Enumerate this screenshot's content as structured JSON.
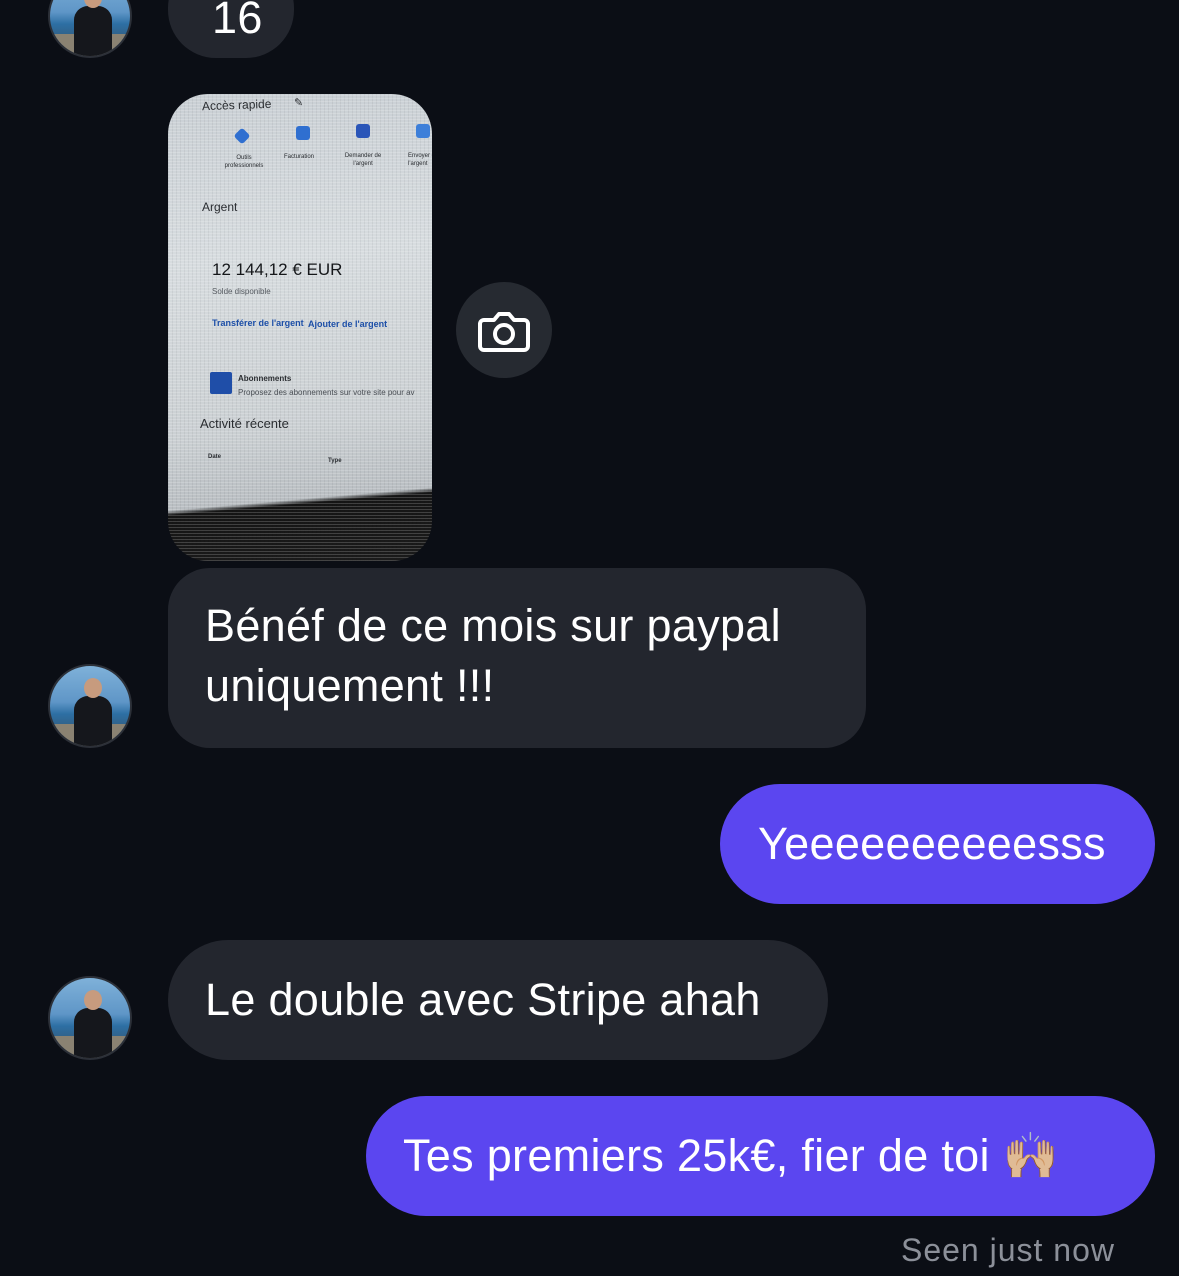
{
  "conversation": {
    "top_partial_message": "16",
    "image_message": {
      "quick_access_title": "Accès rapide",
      "quick_items": [
        "Outils professionnels",
        "Facturation",
        "Demander de l'argent",
        "Envoyer de l'argent"
      ],
      "money_section": "Argent",
      "balance": "12 144,12 € EUR",
      "balance_caption": "Solde disponible",
      "transfer_link": "Transférer de l'argent",
      "add_link": "Ajouter de l'argent",
      "subscriptions_title": "Abonnements",
      "subscriptions_desc": "Proposez des abonnements sur votre site pour av",
      "recent_activity": "Activité récente",
      "col_date": "Date",
      "col_type": "Type"
    },
    "messages": [
      {
        "direction": "in",
        "text_line1": "Bénéf de ce mois sur paypal",
        "text_line2": "uniquement !!!"
      },
      {
        "direction": "out",
        "text": "Yeeeeeeeeeesss"
      },
      {
        "direction": "in",
        "text": "Le double avec Stripe ahah"
      },
      {
        "direction": "out",
        "text": "Tes premiers 25k€, fier de toi 🙌🏼"
      }
    ],
    "seen_status": "Seen just now"
  },
  "icons": {
    "camera": "camera-icon",
    "avatar": "contact-avatar"
  },
  "colors": {
    "background": "#0b0e15",
    "incoming_bubble": "#23262e",
    "outgoing_bubble": "#5b46f0",
    "seen_text": "#8c9099"
  }
}
